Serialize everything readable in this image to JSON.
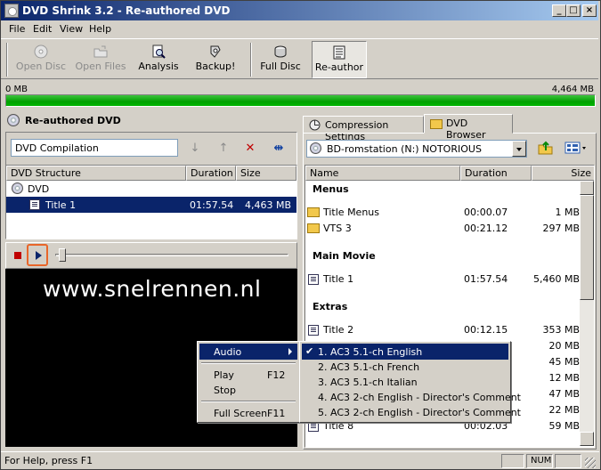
{
  "window": {
    "title": "DVD Shrink 3.2 - Re-authored DVD",
    "controls": {
      "minimize": "_",
      "maximize": "□",
      "close": "×"
    }
  },
  "menubar": [
    "File",
    "Edit",
    "View",
    "Help"
  ],
  "toolbar": {
    "open_disc": "Open Disc",
    "open_files": "Open Files",
    "analysis": "Analysis",
    "backup": "Backup!",
    "full_disc": "Full Disc",
    "reauthor": "Re-author"
  },
  "size_bar": {
    "min_label": "0 MB",
    "max_label": "4,464 MB",
    "fill_percent": 100,
    "fill_color": "#00a000"
  },
  "left_pane": {
    "header": "Re-authored DVD",
    "compilation_name": "DVD Compilation",
    "tools": {
      "move_down": "↓",
      "move_up": "↑",
      "remove": "✕",
      "fit": "⇹"
    },
    "columns": {
      "structure": "DVD Structure",
      "duration": "Duration",
      "size": "Size"
    },
    "tree": {
      "root": "DVD",
      "items": [
        {
          "name": "Title 1",
          "duration": "01:57.54",
          "size": "4,463 MB"
        }
      ]
    },
    "watermark": "www.snelrennen.nl"
  },
  "right_pane": {
    "tabs": {
      "compression": "Compression Settings",
      "browser": "DVD Browser"
    },
    "drive": "BD-romstation (N:) NOTORIOUS",
    "columns": {
      "name": "Name",
      "duration": "Duration",
      "size": "Size"
    },
    "sections": {
      "menus": "Menus",
      "main_movie": "Main Movie",
      "extras": "Extras"
    },
    "menus": [
      {
        "name": "Title Menus",
        "duration": "00:00.07",
        "size": "1 MB"
      },
      {
        "name": "VTS 3",
        "duration": "00:21.12",
        "size": "297 MB"
      }
    ],
    "main_movie": [
      {
        "name": "Title 1",
        "duration": "01:57.54",
        "size": "5,460 MB"
      }
    ],
    "extras": [
      {
        "name": "Title 2",
        "duration": "00:12.15",
        "size": "353 MB"
      },
      {
        "size": "20 MB"
      },
      {
        "size": "45 MB"
      },
      {
        "size": "12 MB"
      },
      {
        "size": "47 MB"
      },
      {
        "size": "22 MB"
      },
      {
        "name": "Title 8",
        "duration": "00:02.03",
        "size": "59 MB"
      }
    ]
  },
  "context_menu": {
    "audio": "Audio",
    "play": "Play",
    "play_shortcut": "F12",
    "stop": "Stop",
    "full_screen": "Full Screen",
    "full_screen_shortcut": "F11"
  },
  "audio_submenu": {
    "check": "✔",
    "items": [
      "1. AC3 5.1-ch English",
      "2. AC3 5.1-ch French",
      "3. AC3 5.1-ch Italian",
      "4. AC3 2-ch English - Director's Comment",
      "5. AC3 2-ch English - Director's Comment"
    ]
  },
  "statusbar": {
    "help": "For Help, press F1",
    "num": "NUM"
  }
}
